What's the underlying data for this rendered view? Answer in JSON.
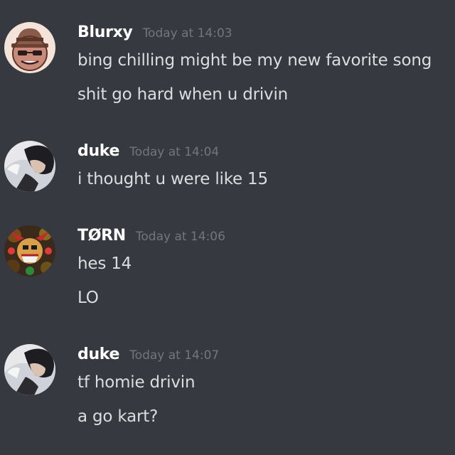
{
  "messages": [
    {
      "author": "Blurxy",
      "timestamp": "Today at 14:03",
      "avatar": "blurxy-avatar",
      "lines": [
        "bing chilling might be my new favorite song",
        "shit go hard when u drivin"
      ]
    },
    {
      "author": "duke",
      "timestamp": "Today at 14:04",
      "avatar": "duke-avatar",
      "lines": [
        "i thought u were like 15"
      ]
    },
    {
      "author": "TØRN",
      "timestamp": "Today at 14:06",
      "avatar": "torn-avatar",
      "lines": [
        "hes 14",
        "LO"
      ]
    },
    {
      "author": "duke",
      "timestamp": "Today at 14:07",
      "avatar": "duke-avatar",
      "lines": [
        "tf homie drivin",
        "a go kart?"
      ]
    }
  ],
  "colors": {
    "background": "#36393f",
    "username": "#ffffff",
    "timestamp": "#72767d",
    "message_text": "#dcddde"
  }
}
